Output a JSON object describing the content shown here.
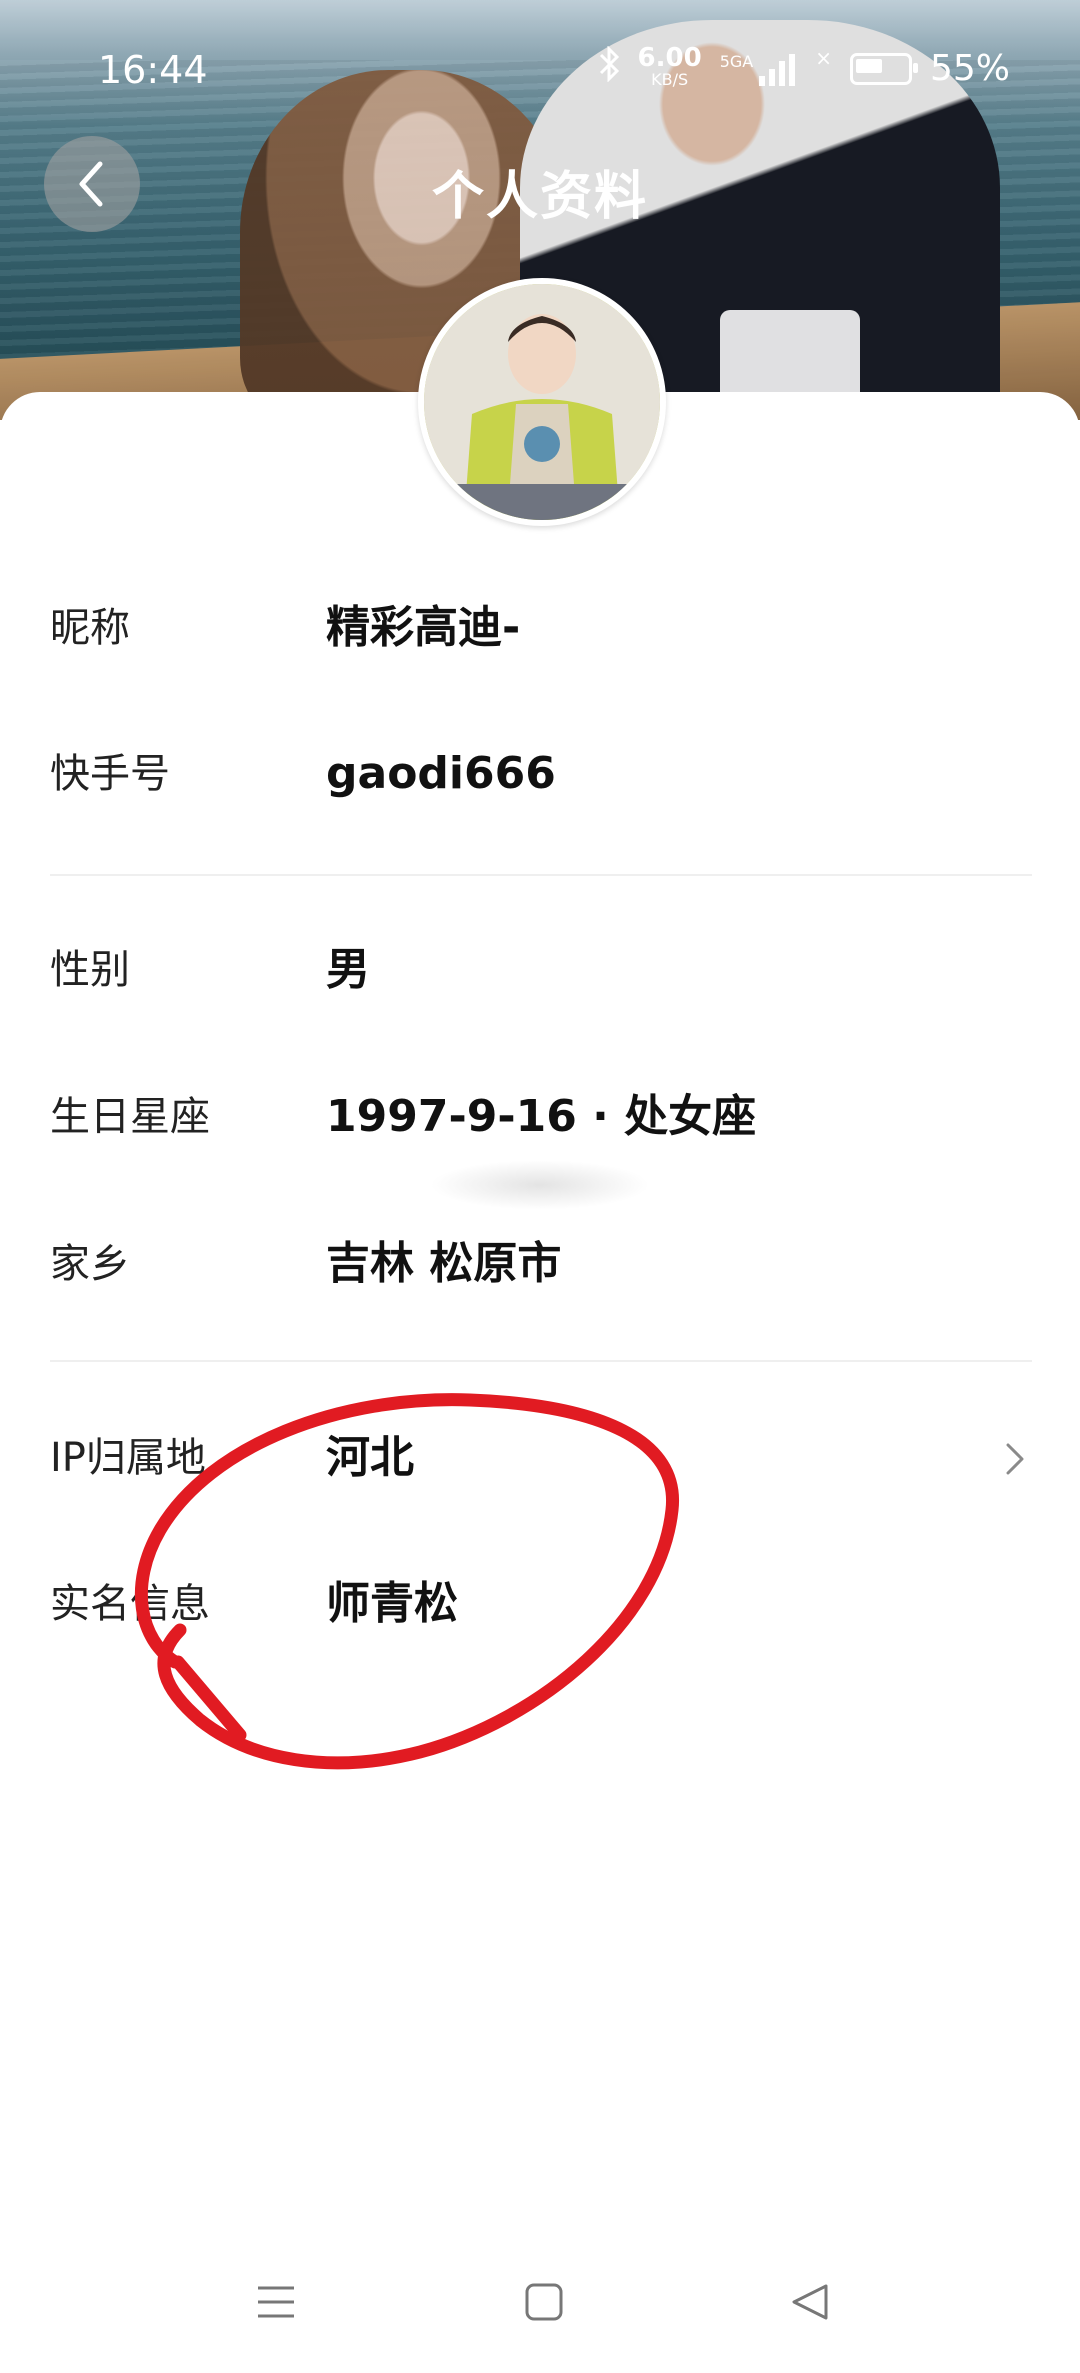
{
  "status_bar": {
    "time": "16:44",
    "net_speed_top": "6.00",
    "net_speed_bottom": "KB/S",
    "network": "5GA",
    "battery_percent": "55%"
  },
  "header": {
    "title": "个人资料"
  },
  "profile": {
    "section1": [
      {
        "label": "昵称",
        "value": "精彩高迪-"
      },
      {
        "label": "快手号",
        "value": "gaodi666"
      }
    ],
    "section2": [
      {
        "label": "性别",
        "value": "男"
      },
      {
        "label": "生日星座",
        "value": "1997-9-16 · 处女座"
      },
      {
        "label": "家乡",
        "value": "吉林 松原市"
      }
    ],
    "section3": [
      {
        "label": "IP归属地",
        "value": "河北"
      },
      {
        "label": "实名信息",
        "value": "师青松"
      }
    ]
  },
  "colors": {
    "annotation": "#e11b22",
    "divider": "#efefef"
  }
}
